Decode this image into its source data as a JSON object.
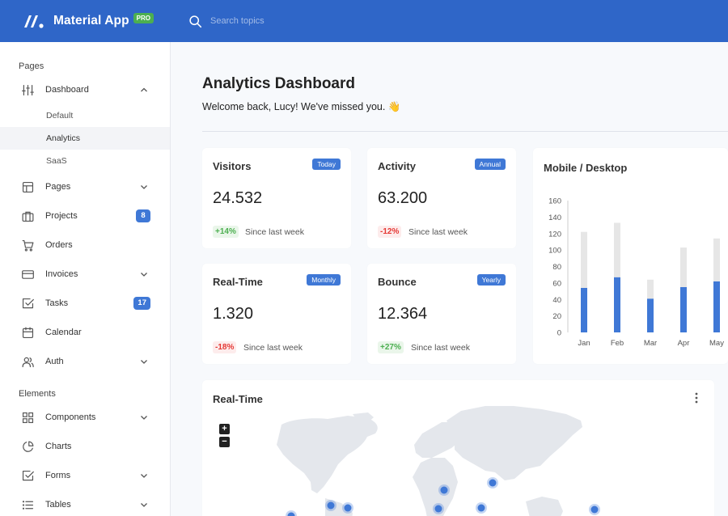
{
  "app": {
    "name": "Material App",
    "badge": "PRO"
  },
  "search": {
    "placeholder": "Search topics"
  },
  "sidebar": {
    "sections": [
      {
        "title": "Pages"
      },
      {
        "title": "Elements"
      }
    ],
    "items": [
      {
        "label": "Dashboard",
        "icon": "sliders-icon"
      },
      {
        "label": "Pages",
        "icon": "layout-icon"
      },
      {
        "label": "Projects",
        "icon": "briefcase-icon",
        "badge": "8"
      },
      {
        "label": "Orders",
        "icon": "cart-icon"
      },
      {
        "label": "Invoices",
        "icon": "card-icon"
      },
      {
        "label": "Tasks",
        "icon": "checkbox-icon",
        "badge": "17"
      },
      {
        "label": "Calendar",
        "icon": "calendar-icon"
      },
      {
        "label": "Auth",
        "icon": "users-icon"
      },
      {
        "label": "Components",
        "icon": "grid-icon"
      },
      {
        "label": "Charts",
        "icon": "pie-icon"
      },
      {
        "label": "Forms",
        "icon": "checkbox-icon"
      },
      {
        "label": "Tables",
        "icon": "list-icon"
      }
    ],
    "sub_items": [
      {
        "label": "Default"
      },
      {
        "label": "Analytics",
        "active": true
      },
      {
        "label": "SaaS"
      }
    ]
  },
  "page": {
    "title": "Analytics Dashboard",
    "welcome": "Welcome back, Lucy! We've missed you. 👋"
  },
  "stats": [
    {
      "title": "Visitors",
      "badge": "Today",
      "value": "24.532",
      "change": "+14%",
      "since": "Since last week"
    },
    {
      "title": "Activity",
      "badge": "Annual",
      "value": "63.200",
      "change": "-12%",
      "since": "Since last week"
    },
    {
      "title": "Real-Time",
      "badge": "Monthly",
      "value": "1.320",
      "change": "-18%",
      "since": "Since last week"
    },
    {
      "title": "Bounce",
      "badge": "Yearly",
      "value": "12.364",
      "change": "+27%",
      "since": "Since last week"
    }
  ],
  "mobile_desktop": {
    "title": "Mobile / Desktop",
    "chart_data": {
      "type": "bar",
      "stacked": true,
      "categories": [
        "Jan",
        "Feb",
        "Mar",
        "Apr",
        "May"
      ],
      "series": [
        {
          "values": [
            54,
            67,
            41,
            55,
            62
          ],
          "color": "#3f78d6"
        },
        {
          "values": [
            68,
            66,
            23,
            48,
            52
          ],
          "color": "#e6e6e6"
        }
      ],
      "ylim": [
        0,
        160
      ],
      "yticks": [
        160,
        140,
        120,
        100,
        80,
        60,
        40,
        20,
        0
      ]
    }
  },
  "realtime_map": {
    "title": "Real-Time",
    "zoom_in": "+",
    "zoom_out": "−"
  },
  "colors": {
    "primary": "#2f66c8",
    "accent": "#3f78d6",
    "positive": "#4caf50",
    "negative": "#e53935"
  }
}
